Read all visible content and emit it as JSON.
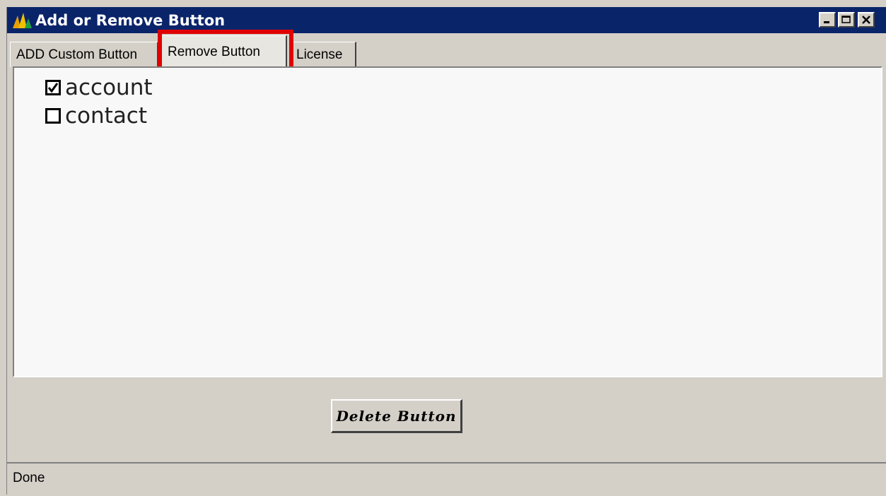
{
  "window": {
    "title": "Add or Remove Button",
    "controls": [
      "minimize-icon",
      "maximize-icon",
      "close-icon"
    ]
  },
  "tabs": [
    {
      "label": "ADD Custom Button"
    },
    {
      "label": "Remove Button",
      "selected": true
    },
    {
      "label": "License"
    }
  ],
  "checkboxes": [
    {
      "label": "account",
      "checked": true
    },
    {
      "label": "contact",
      "checked": false
    }
  ],
  "actions": {
    "delete_label": "Delete Button"
  },
  "status": {
    "text": "Done"
  },
  "colors": {
    "titlebar": "#0a246a",
    "highlight": "#e00000",
    "chrome": "#d4d0c8",
    "panel": "#f8f8f8"
  }
}
